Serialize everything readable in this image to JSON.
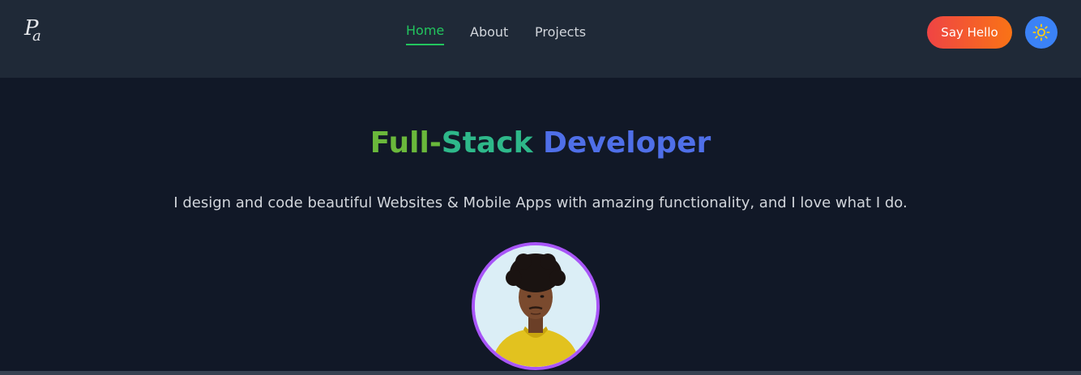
{
  "brand": {
    "logo_p": "P",
    "logo_a": "a"
  },
  "nav": {
    "items": [
      {
        "label": "Home",
        "active": true
      },
      {
        "label": "About",
        "active": false
      },
      {
        "label": "Projects",
        "active": false
      }
    ]
  },
  "actions": {
    "say_hello": "Say Hello",
    "theme_toggle_icon": "sun-icon"
  },
  "hero": {
    "title_part1": "Full-",
    "title_part2": "Stack ",
    "title_part3": "Developer",
    "subtitle": "I design and code beautiful Websites & Mobile Apps with amazing functionality, and I love what I do."
  },
  "colors": {
    "accent_green": "#22c55e",
    "button_gradient_start": "#ef4444",
    "button_gradient_end": "#f97316",
    "theme_button": "#3b82f6",
    "avatar_border": "#a855f7",
    "background": "#111827",
    "navbar": "#1f2937"
  }
}
